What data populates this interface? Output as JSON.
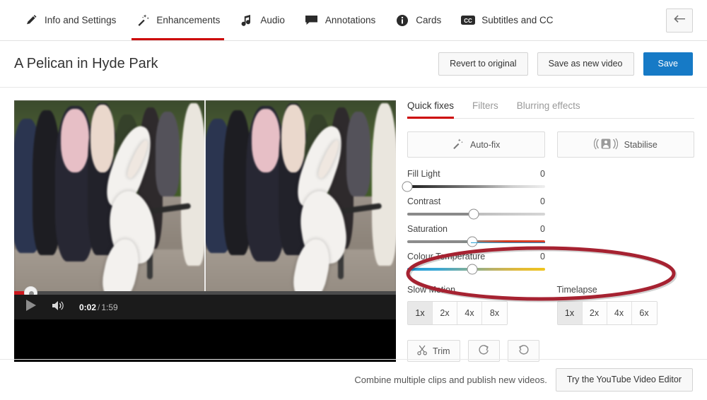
{
  "topnav": {
    "items": [
      {
        "label": "Info and Settings",
        "icon": "pencil-icon",
        "active": false
      },
      {
        "label": "Enhancements",
        "icon": "magic-wand-icon",
        "active": true
      },
      {
        "label": "Audio",
        "icon": "music-note-icon",
        "active": false
      },
      {
        "label": "Annotations",
        "icon": "speech-bubble-icon",
        "active": false
      },
      {
        "label": "Cards",
        "icon": "info-circle-icon",
        "active": false
      },
      {
        "label": "Subtitles and CC",
        "icon": "cc-icon",
        "active": false
      }
    ],
    "back_button": "back-arrow-icon",
    "active_underline_color": "#cc0000"
  },
  "titlebar": {
    "title": "A Pelican in Hyde Park",
    "revert_label": "Revert to original",
    "save_as_new_label": "Save as new video",
    "save_label": "Save",
    "save_color": "#167ac6"
  },
  "player": {
    "current_time": "0:02",
    "separator": "/",
    "duration": "1:59",
    "play_icon": "play-icon",
    "volume_icon": "volume-icon",
    "scene_description": "Pelican walking on a park path in front of a crowd of people",
    "progress_percent": 4
  },
  "panel": {
    "tabs": [
      {
        "label": "Quick fixes",
        "active": true
      },
      {
        "label": "Filters",
        "active": false
      },
      {
        "label": "Blurring effects",
        "active": false
      }
    ],
    "quick_buttons": [
      {
        "label": "Auto-fix",
        "icon": "magic-wand-icon"
      },
      {
        "label": "Stabilise",
        "icon": "stabilise-icon"
      }
    ],
    "sliders": [
      {
        "label": "Fill Light",
        "value": "0",
        "knob_percent": 0,
        "track": "fill"
      },
      {
        "label": "Contrast",
        "value": "0",
        "knob_percent": 48,
        "track": "contrast"
      },
      {
        "label": "Saturation",
        "value": "0",
        "knob_percent": 47,
        "track": "saturation"
      },
      {
        "label": "Colour Temperature",
        "value": "0",
        "knob_percent": 47,
        "track": "temperature"
      }
    ],
    "speed_groups": [
      {
        "label": "Slow Motion",
        "options": [
          "1x",
          "2x",
          "4x",
          "8x"
        ],
        "selected": "1x"
      },
      {
        "label": "Timelapse",
        "options": [
          "1x",
          "2x",
          "4x",
          "6x"
        ],
        "selected": "1x"
      }
    ],
    "tools": [
      {
        "label": "Trim",
        "icon": "scissors-icon"
      },
      {
        "label": "",
        "icon": "rotate-right-icon"
      },
      {
        "label": "",
        "icon": "rotate-left-icon"
      }
    ],
    "annotation": {
      "shape": "ellipse",
      "color": "#a62231",
      "encircles": "Slow Motion and Timelapse speed buttons"
    }
  },
  "footer": {
    "text": "Combine multiple clips and publish new videos.",
    "button_label": "Try the YouTube Video Editor"
  }
}
